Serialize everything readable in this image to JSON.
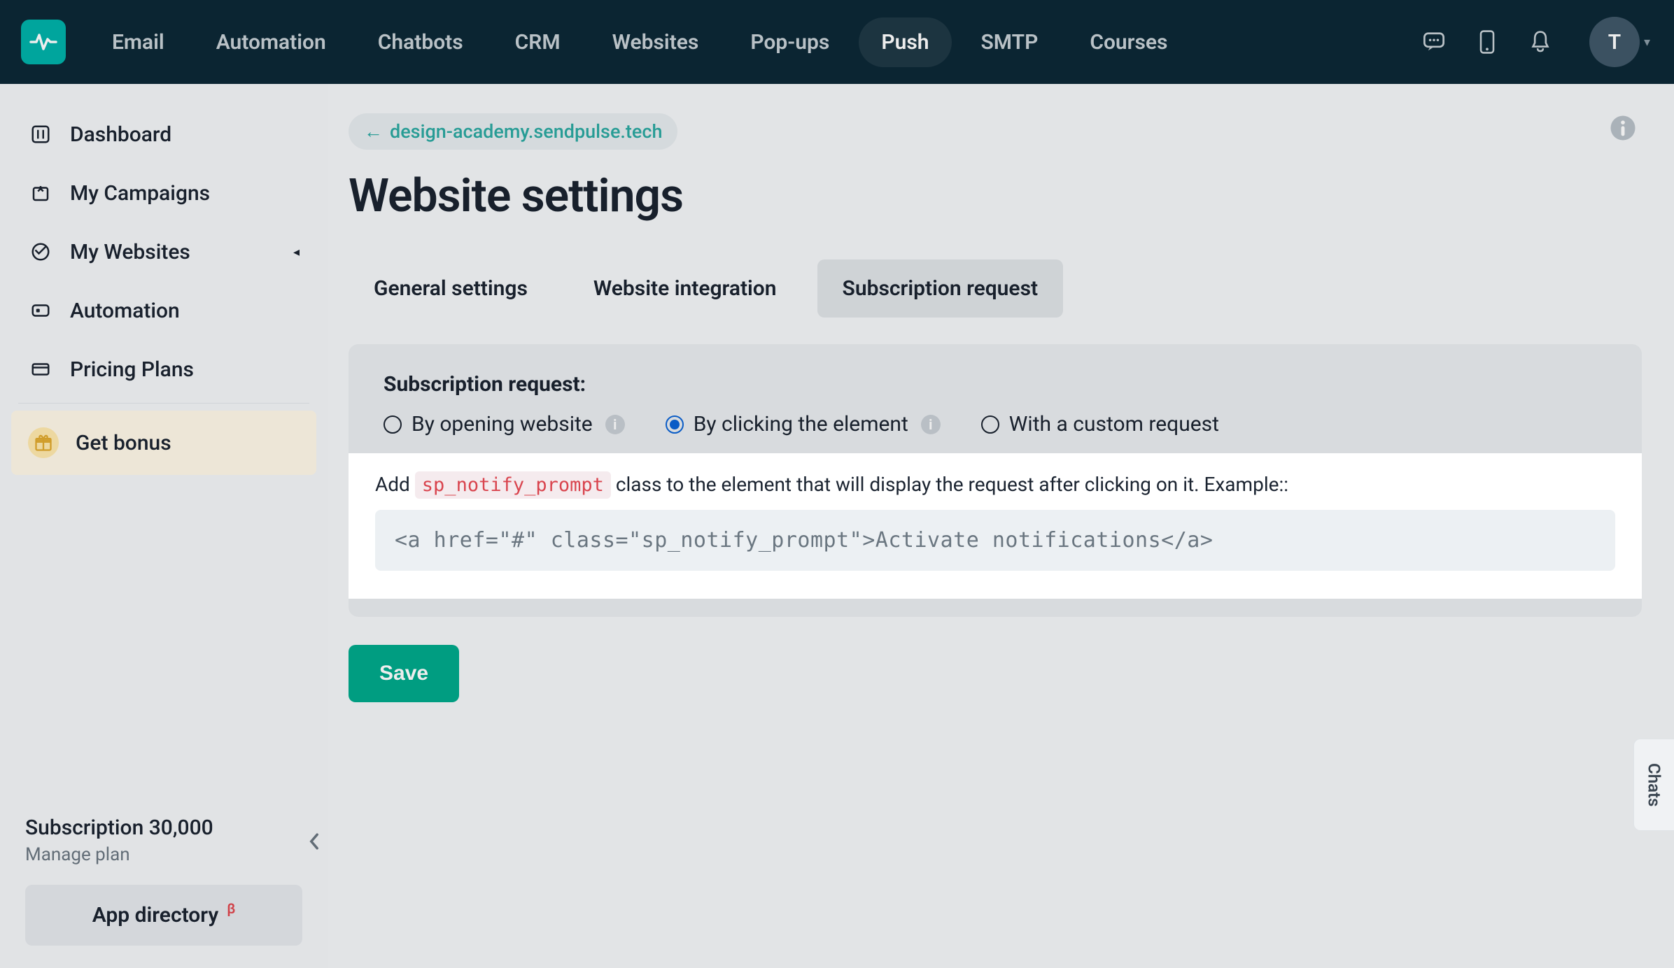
{
  "topnav": {
    "items": [
      "Email",
      "Automation",
      "Chatbots",
      "CRM",
      "Websites",
      "Pop-ups",
      "Push",
      "SMTP",
      "Courses"
    ],
    "active": "Push",
    "avatar_letter": "T"
  },
  "sidebar": {
    "items": [
      {
        "label": "Dashboard",
        "icon": "dashboard"
      },
      {
        "label": "My Campaigns",
        "icon": "campaigns"
      },
      {
        "label": "My Websites",
        "icon": "websites",
        "has_caret": true
      },
      {
        "label": "Automation",
        "icon": "automation"
      },
      {
        "label": "Pricing Plans",
        "icon": "pricing"
      }
    ],
    "bonus_label": "Get bonus",
    "subscription_line": "Subscription 30,000",
    "manage_label": "Manage plan",
    "app_directory_label": "App directory",
    "beta_badge": "β"
  },
  "main": {
    "breadcrumb": "design-academy.sendpulse.tech",
    "title": "Website settings",
    "tabs": [
      "General settings",
      "Website integration",
      "Subscription request"
    ],
    "active_tab": "Subscription request",
    "panel_heading": "Subscription request:",
    "radios": [
      {
        "label": "By opening website",
        "info": true
      },
      {
        "label": "By clicking the element",
        "info": true
      },
      {
        "label": "With a custom request",
        "info": false
      }
    ],
    "selected_radio": "By clicking the element",
    "instruction_pre": "Add ",
    "instruction_code": "sp_notify_prompt",
    "instruction_post": " class to the element that will display the request after clicking on it. Example::",
    "code_example": "<a href=\"#\" class=\"sp_notify_prompt\">Activate notifications</a>",
    "save_label": "Save"
  },
  "chats_tab": "Chats"
}
